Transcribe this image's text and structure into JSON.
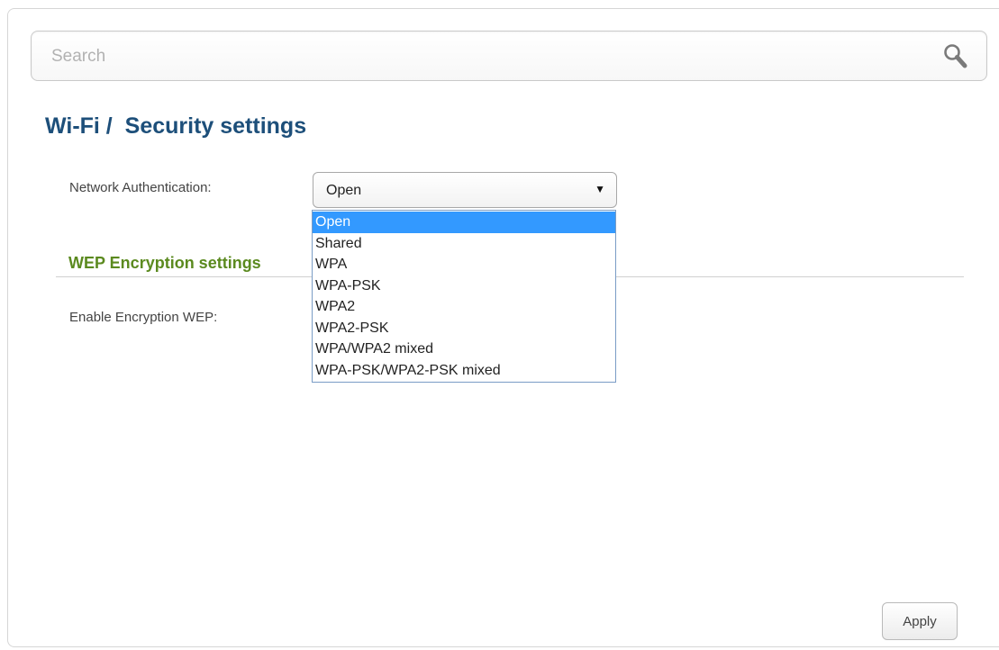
{
  "search": {
    "placeholder": "Search",
    "icon": "search-icon"
  },
  "page": {
    "title": "Wi-Fi /  Security settings"
  },
  "authentication": {
    "label": "Network Authentication:",
    "selected": "Open",
    "options": [
      "Open",
      "Shared",
      "WPA",
      "WPA-PSK",
      "WPA2",
      "WPA2-PSK",
      "WPA/WPA2 mixed",
      "WPA-PSK/WPA2-PSK mixed"
    ]
  },
  "wep": {
    "section_title": "WEP Encryption settings",
    "enable_label": "Enable Encryption WEP:"
  },
  "actions": {
    "apply_label": "Apply"
  },
  "colors": {
    "title": "#1d4f7a",
    "section_title": "#5b8a1f",
    "dropdown_highlight": "#3399ff"
  }
}
